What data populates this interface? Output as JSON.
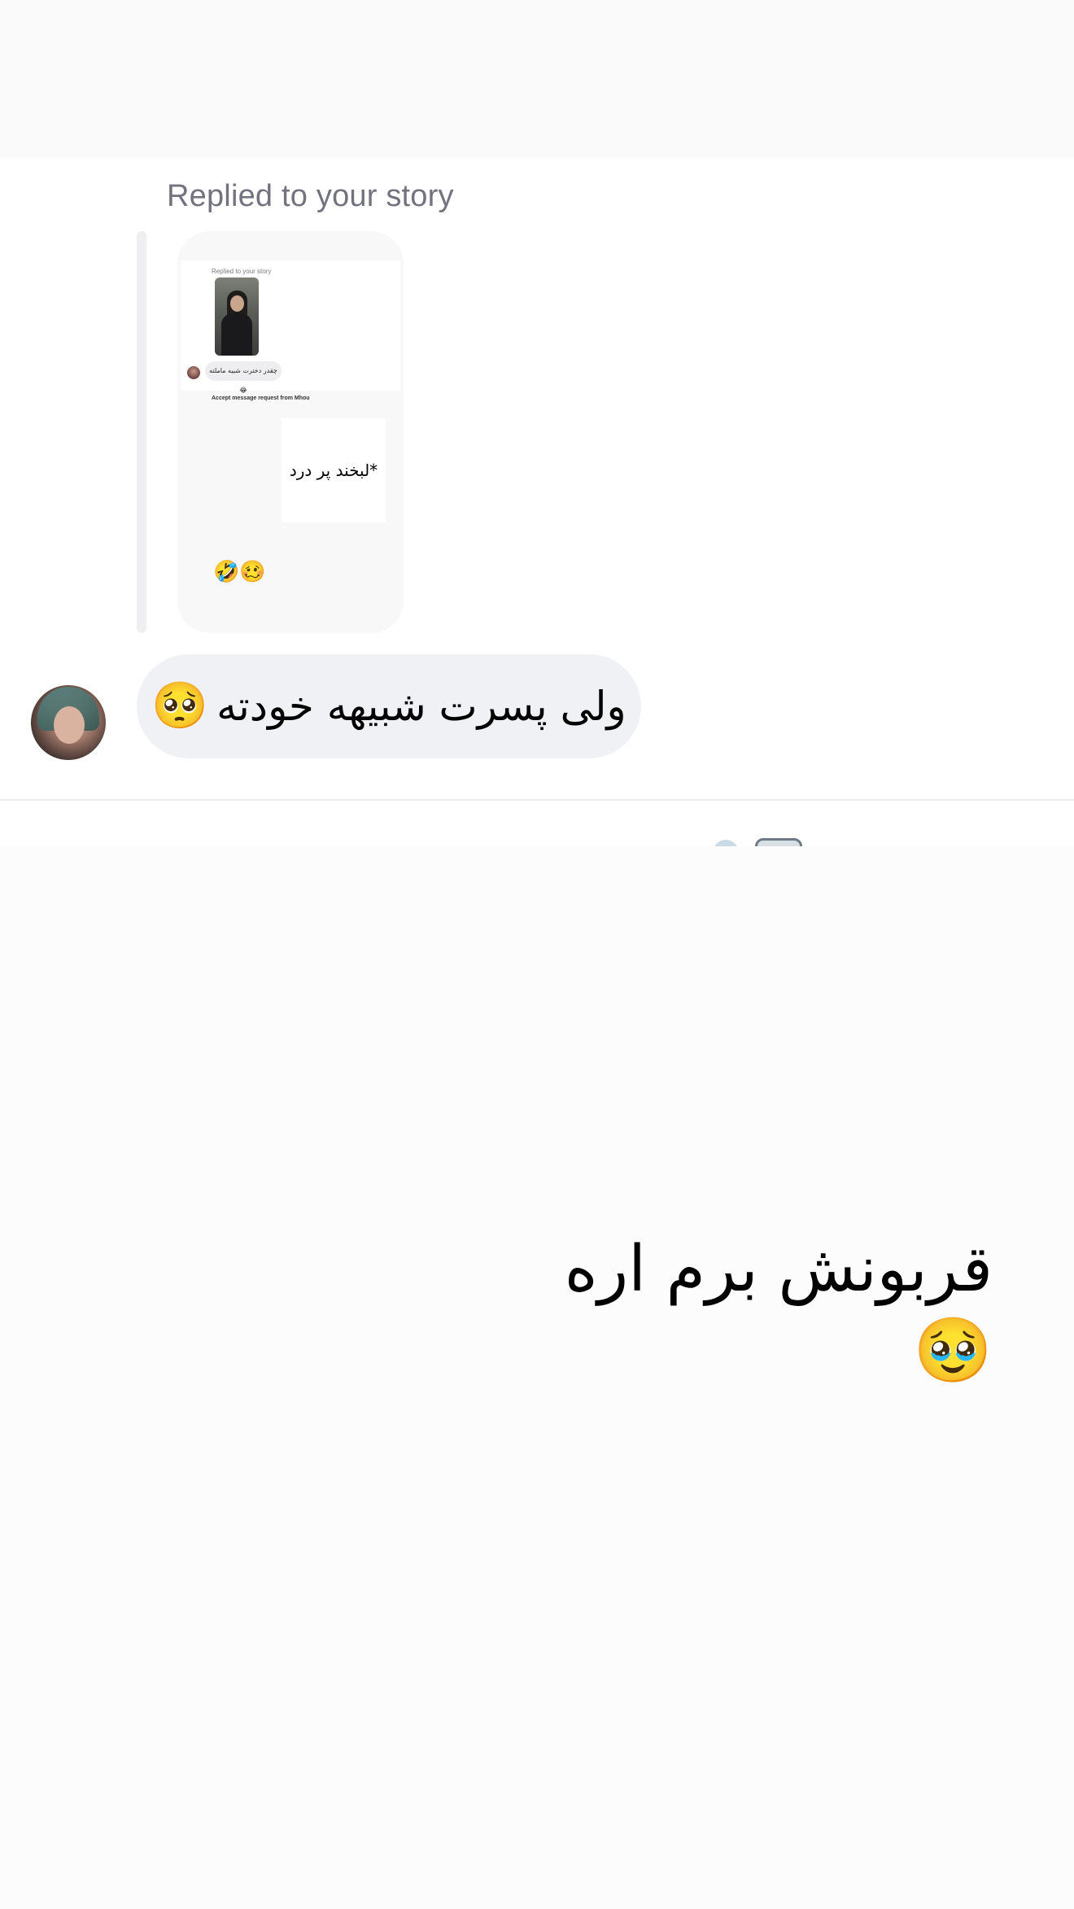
{
  "story_reply": {
    "label": "Replied to your story",
    "card": {
      "mini_label": "Replied to your story",
      "mini_bubble_text": "چقدر دخترت شبیه ماملته 😂",
      "mini_accept_text": "Accept message request from Mhou",
      "sticker_text": "*لبخند پر درد",
      "emoji": "🤣🥴"
    }
  },
  "message": {
    "text": "ولی پسرت شبیهه خودته",
    "emoji": "🥺"
  },
  "caption": {
    "text": "قربونش برم اره🥹"
  },
  "colors": {
    "bubble_bg": "#f0f1f4",
    "label_gray": "#737380",
    "page_bg": "#fcfcfc"
  }
}
